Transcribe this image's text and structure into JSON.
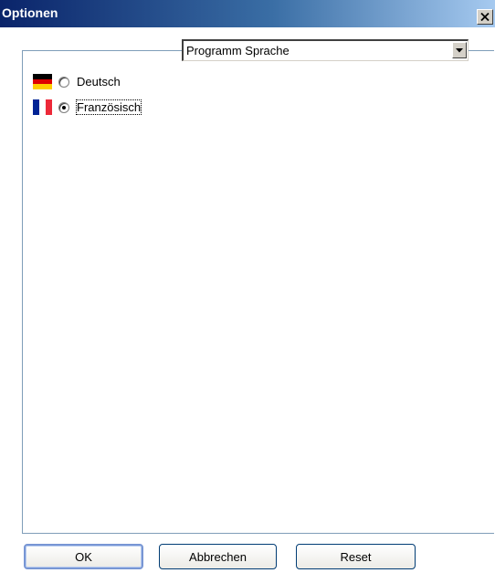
{
  "window": {
    "title": "Optionen",
    "close_icon": "close-icon"
  },
  "language_select": {
    "selected": "Programm Sprache",
    "arrow_icon": "chevron-down-icon"
  },
  "languages": [
    {
      "label": "Deutsch",
      "flag_icon": "german-flag-icon",
      "selected": false
    },
    {
      "label": "Französisch",
      "flag_icon": "french-flag-icon",
      "selected": true
    }
  ],
  "buttons": {
    "ok_label": "OK",
    "cancel_label": "Abbrechen",
    "reset_label": "Reset"
  },
  "colors": {
    "titlebar_dark": "#0a246a",
    "titlebar_light": "#a6caf0",
    "german_flag": [
      "#000000",
      "#dd0000",
      "#ffce00"
    ],
    "french_flag": [
      "#002395",
      "#ffffff",
      "#ed2939"
    ]
  }
}
